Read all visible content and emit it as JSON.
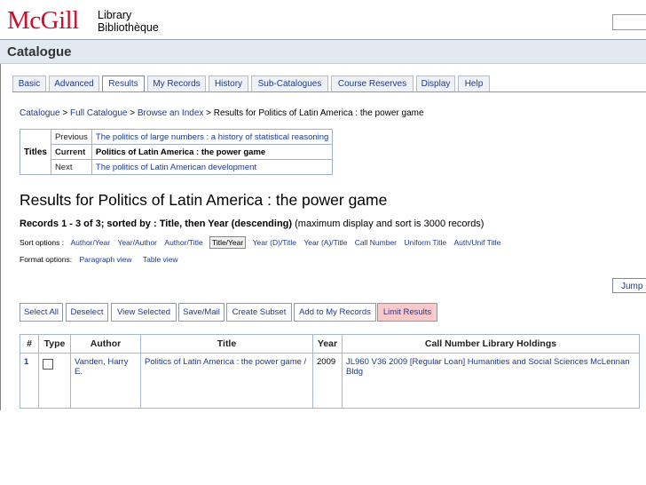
{
  "header": {
    "logo_text": "McGill",
    "library_line1": "Library",
    "library_line2": "Bibliothèque"
  },
  "catalogue_title": "Catalogue",
  "tabs": [
    "Basic",
    "Advanced",
    "Results",
    "My Records",
    "History",
    "Sub-Catalogues",
    "Course Reserves",
    "Display",
    "Help"
  ],
  "active_tab": "Results",
  "breadcrumb": {
    "items": [
      "Catalogue",
      "Full Catalogue",
      "Browse an Index"
    ],
    "current": "Results for Politics of Latin America : the power game",
    "sep": " > "
  },
  "titles_nav": {
    "label": "Titles",
    "rows": [
      {
        "label": "Previous",
        "value": "The politics of large numbers : a history of statistical reasoning"
      },
      {
        "label": "Current",
        "value": "Politics of Latin America : the power game"
      },
      {
        "label": "Next",
        "value": "The politics of Latin American development"
      }
    ]
  },
  "results_heading": "Results for Politics of Latin America : the power game",
  "records": {
    "prefix": "Records 1 - 3 of 3; sorted by : Title, then Year (descending)",
    "note": " (maximum display and sort is 3000 records)"
  },
  "sort": {
    "label": "Sort options :",
    "options": [
      "Author/Year",
      "Year/Author",
      "Author/Title",
      "Title/Year",
      "Year (D)/Title",
      "Year (A)/Title",
      "Call Number",
      "Uniform Title",
      "Auth/Unif Title"
    ],
    "selected": "Title/Year"
  },
  "format": {
    "label": "Format options:",
    "options": [
      "Paragraph view",
      "Table view"
    ]
  },
  "jump_label": "Jump",
  "actions": [
    "Select All",
    "Deselect",
    "View Selected",
    "Save/Mail",
    "Create Subset",
    "Add to My Records",
    "Limit Results"
  ],
  "table": {
    "headers": [
      "#",
      "Type",
      "Author",
      "Title",
      "Year",
      "Call Number Library Holdings"
    ],
    "rows": [
      {
        "num": "1",
        "author": "Vanden, Harry E.",
        "title": "Politics of Latin America : the power game /",
        "year": "2009",
        "holdings": "JL960 V36 2009 [Regular Loan] Humanities and Social Sciences McLennan Bldg"
      }
    ]
  },
  "colors": {
    "brand_red": "#c8102e",
    "link_blue": "#1a3a8f",
    "limit_button_bg": "#f9c9cc",
    "catalogue_bar_bg": "#e3e9f1"
  }
}
